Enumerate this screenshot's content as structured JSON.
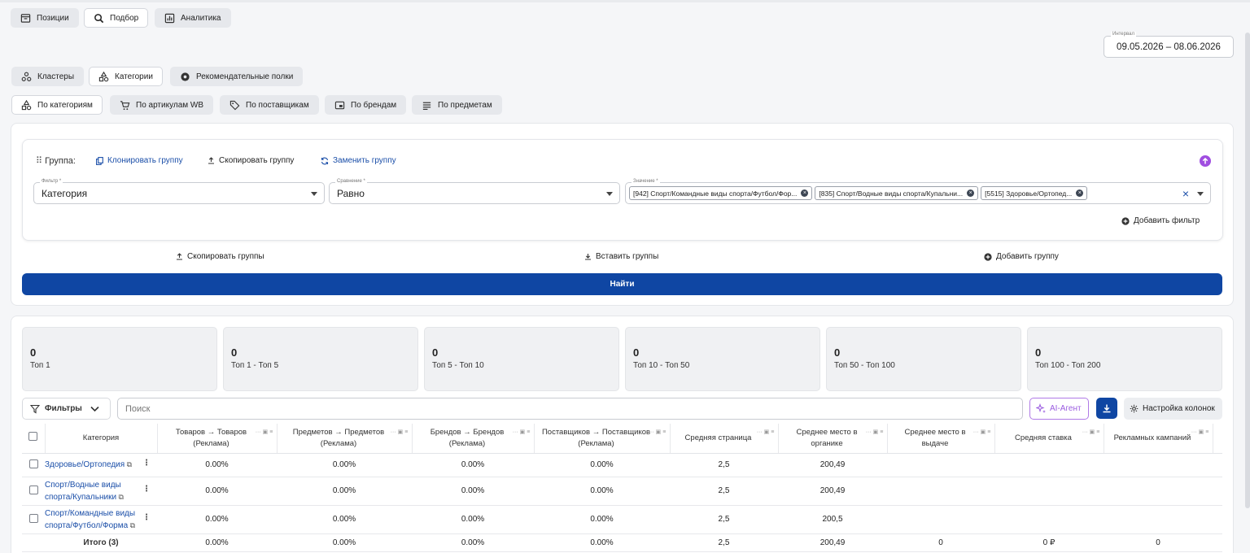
{
  "top_tabs": [
    {
      "label": "Позиции",
      "icon": "archive-icon"
    },
    {
      "label": "Подбор",
      "icon": "search-icon"
    },
    {
      "label": "Аналитика",
      "icon": "chart-icon"
    }
  ],
  "interval": {
    "label": "Интервал",
    "value": "09.05.2026 – 08.06.2026"
  },
  "mode_tabs": [
    {
      "label": "Кластеры",
      "icon": "clusters-icon"
    },
    {
      "label": "Категории",
      "icon": "categories-icon"
    },
    {
      "label": "Рекомендательные полки",
      "icon": "shelf-icon"
    }
  ],
  "sub_tabs": [
    {
      "label": "По категориям",
      "icon": "categories-icon"
    },
    {
      "label": "По артикулам WB",
      "icon": "cart-icon"
    },
    {
      "label": "По поставщикам",
      "icon": "tag-icon"
    },
    {
      "label": "По брендам",
      "icon": "brand-icon"
    },
    {
      "label": "По предметам",
      "icon": "list-icon"
    }
  ],
  "group": {
    "label": "Группа:",
    "clone": "Клонировать группу",
    "copy": "Скопировать группу",
    "replace": "Заменить группу",
    "filter_label": "Фильтр *",
    "filter_value": "Категория",
    "compare_label": "Сравнение *",
    "compare_value": "Равно",
    "values_label": "Значение *",
    "tags": [
      "[942] Спорт/Командные виды спорта/Футбол/Фор...",
      "[835] Спорт/Водные виды спорта/Купальни...",
      "[5515] Здоровье/Ортопед..."
    ],
    "add_filter": "Добавить фильтр"
  },
  "actions": {
    "copy_groups": "Скопировать группы",
    "paste_groups": "Вставить группы",
    "add_group": "Добавить группу",
    "find": "Найти"
  },
  "stats": [
    {
      "value": "0",
      "label": "Топ 1"
    },
    {
      "value": "0",
      "label": "Топ 1 - Топ 5"
    },
    {
      "value": "0",
      "label": "Топ 5 - Топ 10"
    },
    {
      "value": "0",
      "label": "Топ 10 - Топ 50"
    },
    {
      "value": "0",
      "label": "Топ 50 - Топ 100"
    },
    {
      "value": "0",
      "label": "Топ 100 - Топ 200"
    }
  ],
  "toolbar": {
    "filters": "Фильтры",
    "search_placeholder": "Поиск",
    "ai": "AI-Агент",
    "columns": "Настройка колонок"
  },
  "table": {
    "columns": [
      "Категория",
      "Товаров → Товаров (Реклама)",
      "Предметов → Предметов (Реклама)",
      "Брендов → Брендов (Реклама)",
      "Поставщиков → Поставщиков (Реклама)",
      "Средняя страница",
      "Среднее место в органике",
      "Среднее место в выдаче",
      "Средняя ставка",
      "Рекламных кампаний"
    ],
    "rows": [
      {
        "category": "Здоровье/Ортопедия",
        "cells": [
          "0.00%",
          "0.00%",
          "0.00%",
          "0.00%",
          "2,5",
          "200,49",
          "",
          "",
          ""
        ]
      },
      {
        "category": "Спорт/Водные виды спорта/Купальники",
        "cells": [
          "0.00%",
          "0.00%",
          "0.00%",
          "0.00%",
          "2,5",
          "200,49",
          "",
          "",
          ""
        ]
      },
      {
        "category": "Спорт/Командные виды спорта/Футбол/Форма",
        "cells": [
          "0.00%",
          "0.00%",
          "0.00%",
          "0.00%",
          "2,5",
          "200,5",
          "",
          "",
          ""
        ]
      }
    ],
    "total": {
      "label": "Итого (3)",
      "cells": [
        "0.00%",
        "0.00%",
        "0.00%",
        "0.00%",
        "2,5",
        "200,49",
        "0",
        "0 ₽",
        "0"
      ]
    }
  }
}
